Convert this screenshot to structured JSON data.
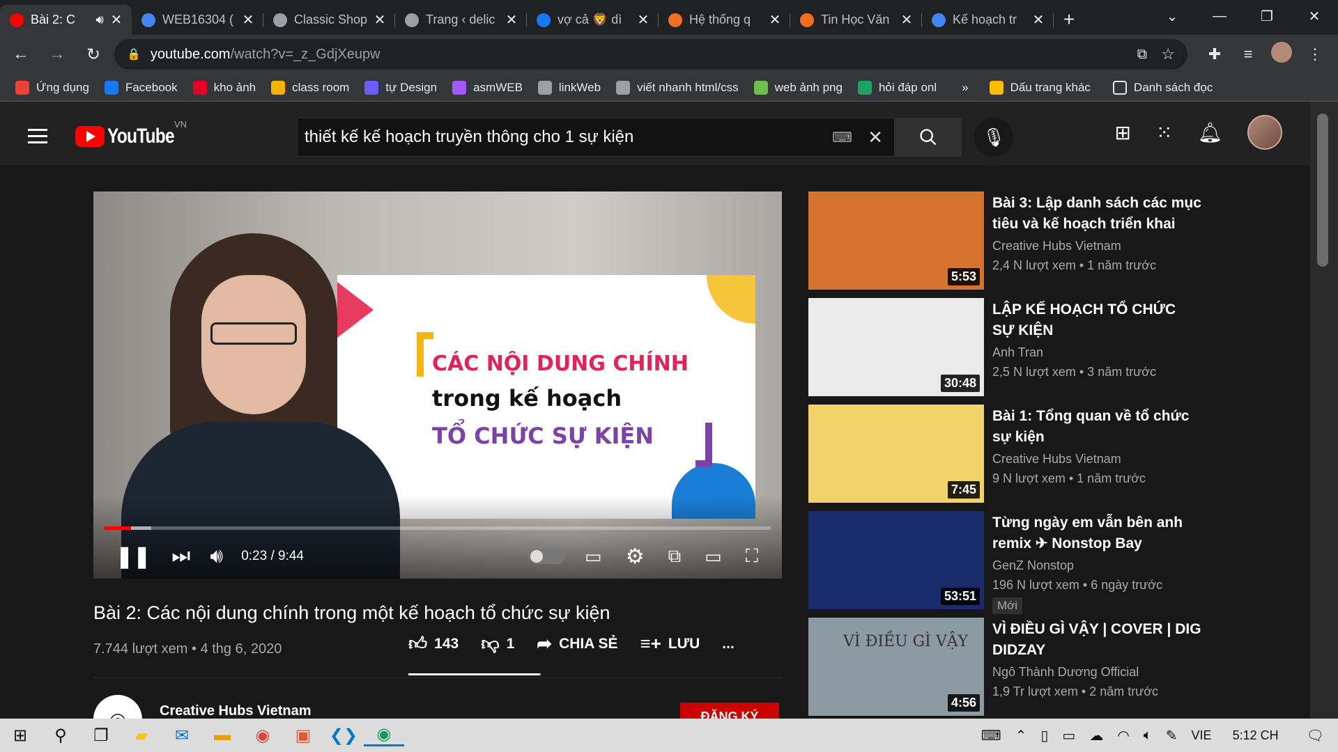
{
  "tabs": [
    {
      "title": "Bài 2: C",
      "favicon": "youtube-icon",
      "color": "#ff0000"
    },
    {
      "title": "WEB16304 (",
      "favicon": "user-icon",
      "color": "#4285f4"
    },
    {
      "title": "Classic Shop",
      "favicon": "globe-icon",
      "color": "#9aa0a6"
    },
    {
      "title": "Trang ‹ delic",
      "favicon": "globe-icon",
      "color": "#9aa0a6"
    },
    {
      "title": "vợ cả 🦁 dì",
      "favicon": "facebook-icon",
      "color": "#1877f2"
    },
    {
      "title": "Hệ thống q",
      "favicon": "fpt-icon",
      "color": "#f26f21"
    },
    {
      "title": "Tin Học Văn",
      "favicon": "fpt-icon",
      "color": "#f26f21"
    },
    {
      "title": "Kế hoạch tr",
      "favicon": "arrow-icon",
      "color": "#4285f4"
    }
  ],
  "url": {
    "host": "youtube.com",
    "path": "/watch?v=_z_GdjXeupw"
  },
  "bookmarks": [
    {
      "label": "Ứng dụng",
      "color": "#ea4335"
    },
    {
      "label": "Facebook",
      "color": "#1877f2"
    },
    {
      "label": "kho ảnh",
      "color": "#e60023"
    },
    {
      "label": "class room",
      "color": "#f4b400"
    },
    {
      "label": "tự Design",
      "color": "#6a5cff"
    },
    {
      "label": "asmWEB",
      "color": "#a259ff"
    },
    {
      "label": "linkWeb",
      "color": "#9aa0a6"
    },
    {
      "label": "viết nhanh html/css",
      "color": "#9aa0a6"
    },
    {
      "label": "web ảnh png",
      "color": "#6cc04a"
    },
    {
      "label": "hỏi đáp onl",
      "color": "#1ba363"
    }
  ],
  "bookmarks_more": "»",
  "bookmarks_other": "Dấu trang khác",
  "reading_list": "Danh sách đọc",
  "yt": {
    "logo": "YouTube",
    "country": "VN",
    "search": "thiết kế kế hoạch truyền thông cho 1 sự kiện"
  },
  "video": {
    "slide_line1": "CÁC NỘI DUNG CHÍNH",
    "slide_line2": "trong kế hoạch",
    "slide_line3": "TỔ CHỨC SỰ KIỆN",
    "time": "0:23 / 9:44",
    "progress": 0.04,
    "buffered": 0.07,
    "title": "Bài 2: Các nội dung chính trong một kế hoạch tổ chức sự kiện",
    "meta": "7.744 lượt xem • 4 thg 6, 2020",
    "likes": "143",
    "dislikes": "1",
    "share": "CHIA SẺ",
    "save": "LƯU",
    "more": "...",
    "channel": "Creative Hubs Vietnam",
    "subscribe": "ĐĂNG KÝ"
  },
  "related": [
    {
      "title": "Bài 3: Lập danh sách các mục tiêu và kế hoạch triển khai",
      "channel": "Creative Hubs Vietnam",
      "views": "2,4 N lượt xem • 1 năm trước",
      "duration": "5:53",
      "thumb": "#d8722f"
    },
    {
      "title": "LẬP KẾ HOẠCH TỔ CHỨC SỰ KIỆN",
      "channel": "Anh Tran",
      "views": "2,5 N lượt xem • 3 năm trước",
      "duration": "30:48",
      "thumb": "#eaeaea"
    },
    {
      "title": "Bài 1: Tổng quan về tổ chức sự kiện",
      "channel": "Creative Hubs Vietnam",
      "views": "9 N lượt xem • 1 năm trước",
      "duration": "7:45",
      "thumb": "#f2d36b"
    },
    {
      "title": "Từng ngày em vẫn bên anh remix ✈ Nonstop Bay Phòng…",
      "channel": "GenZ Nonstop",
      "views": "196 N lượt xem • 6 ngày trước",
      "duration": "53:51",
      "badge": "Mới",
      "thumb": "#1a2b6b"
    },
    {
      "title": "VÌ ĐIỀU GÌ VẬY | COVER | DIG DIDZAY (#NGOTHANHDUONG)",
      "channel": "Ngô Thành Dương Official",
      "views": "1,9 Tr lượt xem • 2 năm trước",
      "duration": "4:56",
      "thumb": "#8c9aa3",
      "thumb_text": "VÌ ĐIỀU GÌ VẬY"
    }
  ],
  "taskbar": {
    "lang": "VIE",
    "time": "5:12 CH"
  }
}
